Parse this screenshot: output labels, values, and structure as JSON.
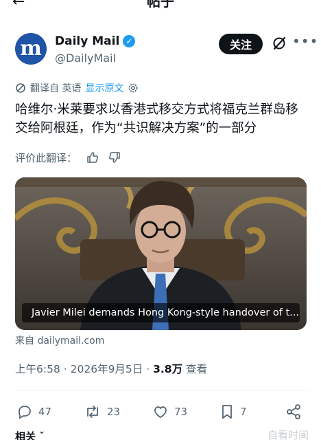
{
  "topbar": {
    "back_icon": "back-arrow-icon",
    "title": "帖子"
  },
  "author": {
    "avatar_letter": "m",
    "name": "Daily Mail",
    "handle": "@DailyMail",
    "follow_label": "关注",
    "verified_icon": "verified-badge-icon"
  },
  "translation": {
    "icon": "translate-icon",
    "label": "翻译自 英语",
    "show_original": "显示原文",
    "settings_icon": "gear-icon"
  },
  "tweet": {
    "text": "哈维尔·米莱要求以香港式移交方式将福克兰群岛移交给阿根廷，作为“共识解决方案”的一部分"
  },
  "rate": {
    "label": "评价此翻译："
  },
  "media": {
    "caption": "Javier Milei demands Hong Kong-style handover of t..."
  },
  "source": {
    "text": "来自 dailymail.com"
  },
  "meta": {
    "time": "上午6:58",
    "separator": "·",
    "date": "2026年9月5日",
    "views": "3.8万",
    "views_label": "查看"
  },
  "actions": {
    "replies": "47",
    "reposts": "23",
    "likes": "73",
    "bookmarks": "7"
  },
  "related": {
    "label": "相关"
  },
  "watermark": {
    "text": "自看时间"
  },
  "colors": {
    "accent": "#1d9bf0",
    "text": "#0f1419",
    "muted": "#536471",
    "avatar": "#1f54a6"
  }
}
